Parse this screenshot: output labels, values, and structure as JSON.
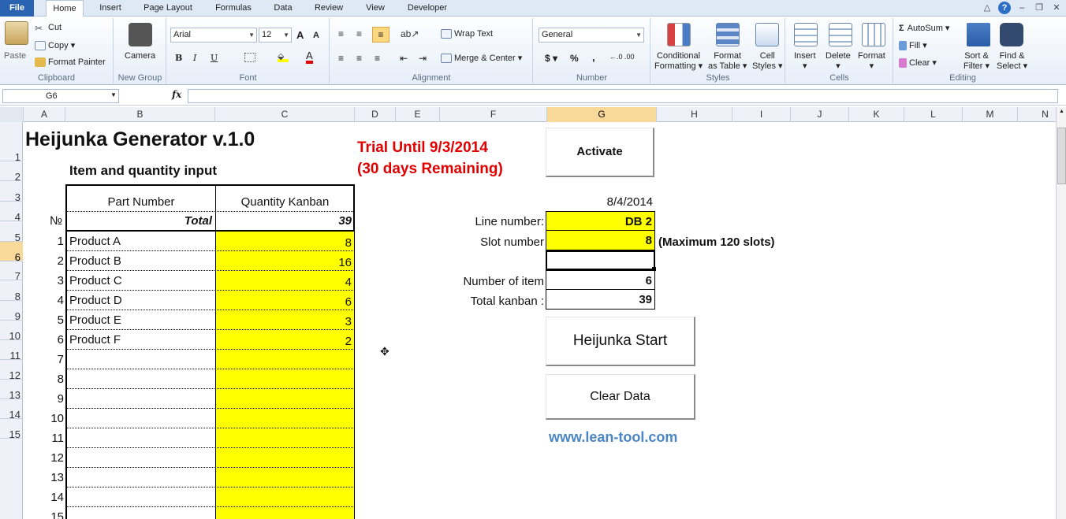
{
  "tabs": {
    "file": "File",
    "home": "Home",
    "insert": "Insert",
    "page_layout": "Page Layout",
    "formulas": "Formulas",
    "data": "Data",
    "review": "Review",
    "view": "View",
    "developer": "Developer"
  },
  "clipboard": {
    "paste": "Paste",
    "cut": "Cut",
    "copy": "Copy",
    "format_painter": "Format Painter",
    "label": "Clipboard"
  },
  "new_group": {
    "camera": "Camera",
    "label": "New Group"
  },
  "font": {
    "name": "Arial",
    "size": "12",
    "bold": "B",
    "italic": "I",
    "underline": "U",
    "grow": "A",
    "shrink": "A",
    "label": "Font"
  },
  "alignment": {
    "wrap_text": "Wrap Text",
    "merge_center": "Merge & Center",
    "label": "Alignment"
  },
  "number": {
    "format": "General",
    "currency": "$",
    "percent": "%",
    "comma": ",",
    "inc_dec": "←.0 .00",
    "dec_dec": ".00 →.0",
    "label": "Number"
  },
  "styles": {
    "conditional": [
      "Conditional",
      "Formatting ▾"
    ],
    "format_table": [
      "Format",
      "as Table ▾"
    ],
    "cell_styles": [
      "Cell",
      "Styles ▾"
    ],
    "label": "Styles"
  },
  "cells": {
    "insert": "Insert",
    "delete": "Delete",
    "format": "Format",
    "label": "Cells"
  },
  "editing": {
    "autosum": "AutoSum",
    "fill": "Fill",
    "clear": "Clear",
    "sort_filter": [
      "Sort &",
      "Filter ▾"
    ],
    "find_select": [
      "Find &",
      "Select ▾"
    ],
    "label": "Editing"
  },
  "formula_bar": {
    "name_box": "G6",
    "fx": "fx",
    "value": ""
  },
  "columns": [
    "A",
    "B",
    "C",
    "D",
    "E",
    "F",
    "G",
    "H",
    "I",
    "J",
    "K",
    "L",
    "M",
    "N"
  ],
  "selected_column": "G",
  "rows": [
    "1",
    "2",
    "3",
    "4",
    "5",
    "6",
    "7",
    "8",
    "9",
    "10",
    "11",
    "12",
    "13",
    "14",
    "15"
  ],
  "selected_row": "6",
  "sheet": {
    "title": "Heijunka Generator v.1.0",
    "subtitle": "Item and quantity input",
    "trial_line1": "Trial Until 9/3/2014",
    "trial_line2": "(30 days Remaining)",
    "col_part": "Part Number",
    "col_qty": "Quantity Kanban",
    "no_header": "№",
    "total_label": "Total",
    "total_value": "39",
    "items": [
      {
        "n": "1",
        "name": "Product A",
        "qty": "8"
      },
      {
        "n": "2",
        "name": "Product B",
        "qty": "16"
      },
      {
        "n": "3",
        "name": "Product C",
        "qty": "4"
      },
      {
        "n": "4",
        "name": "Product D",
        "qty": "6"
      },
      {
        "n": "5",
        "name": "Product E",
        "qty": "3"
      },
      {
        "n": "6",
        "name": "Product F",
        "qty": "2"
      },
      {
        "n": "7",
        "name": "",
        "qty": ""
      },
      {
        "n": "8",
        "name": "",
        "qty": ""
      },
      {
        "n": "9",
        "name": "",
        "qty": ""
      },
      {
        "n": "10",
        "name": "",
        "qty": ""
      },
      {
        "n": "11",
        "name": "",
        "qty": ""
      },
      {
        "n": "12",
        "name": "",
        "qty": ""
      },
      {
        "n": "13",
        "name": "",
        "qty": ""
      },
      {
        "n": "14",
        "name": "",
        "qty": ""
      },
      {
        "n": "15",
        "name": "",
        "qty": ""
      }
    ],
    "activate": "Activate",
    "date": "8/4/2014",
    "line_label": "Line number:",
    "line_value": "DB 2",
    "slot_label": "Slot number",
    "slot_value": "8",
    "slot_note": "(Maximum 120 slots)",
    "num_item_label": "Number of  item",
    "num_item_value": "6",
    "total_kanban_label": "Total kanban :",
    "total_kanban_value": "39",
    "heijunka_start": "Heijunka Start",
    "clear_data": "Clear Data",
    "website": "www.lean-tool.com"
  },
  "colors": {
    "accent": "#2a63b2",
    "highlight": "#ffff00",
    "trial": "#e00000",
    "link": "#4a86c5"
  }
}
